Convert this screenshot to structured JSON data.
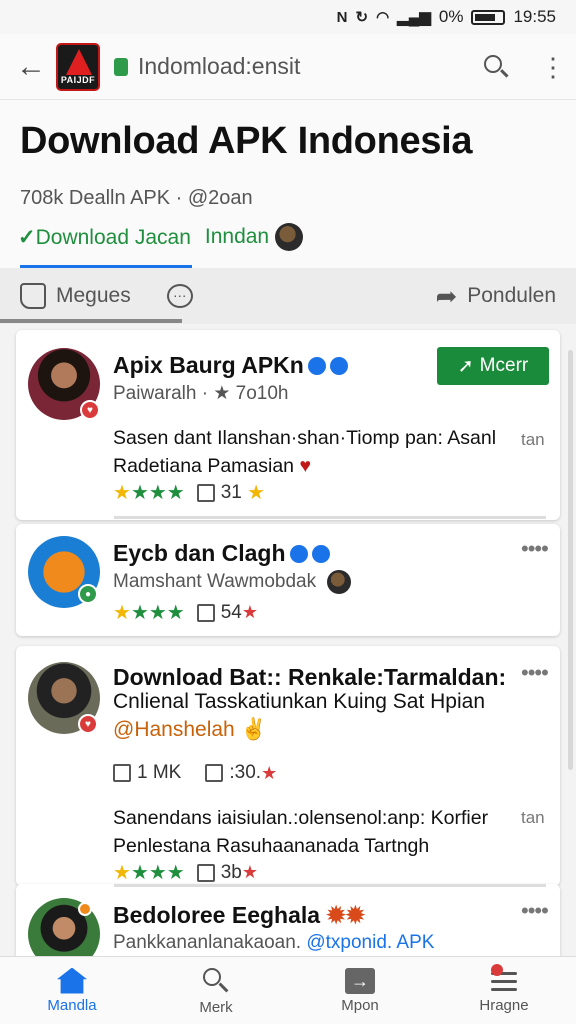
{
  "status_bar": {
    "battery": "0%",
    "time": "19:55",
    "icons": [
      "nfc-icon",
      "sync-icon",
      "wifi-icon",
      "signal-icon",
      "battery-icon"
    ]
  },
  "app_bar": {
    "url": "Indomload:ensit",
    "logo_text": "PAIJDF"
  },
  "header": {
    "title": "Download APK Indonesia",
    "subtitle": "708k Dealln APK · @2oan",
    "verified_label": "Download Jacan",
    "indo_label": "Inndan"
  },
  "action_bar": {
    "like_label": "Megues",
    "share_label": "Pondulen"
  },
  "posts": [
    {
      "title": "Apix Baurg APKn",
      "meta": "Paiwaralh · ★ 7o10h",
      "follow_label": "Mcerr",
      "body_line1": "Sasen dant Ilanshan·shan·Tiomp pan: Asanl",
      "body_line2": "Radetiana Pamasian",
      "side": "tan",
      "stat_count": "31"
    },
    {
      "title": "Eycb dan Clagh",
      "meta": "Mamshant Wawmobdak",
      "stat_count": "54"
    },
    {
      "title": "Download Bat:: Renkale:Tarmaldan:",
      "title_line2": "Cnlienal Tasskatiunkan Kuing Sat Hpian",
      "handle": "@Hanshelah",
      "stat_dl": "1 MK",
      "stat_count": ":30.",
      "body_line1": "Sanendans iaisiulan.:olensenol:anp: Korfier",
      "body_line2": "Penlestana Rasuhaananada Tartngh",
      "side": "tan",
      "stat_count2": "3b"
    },
    {
      "title": "Bedoloree Eeghala",
      "meta_prefix": "Pankkananlanakaoan.",
      "mention": "@txponid. APK"
    }
  ],
  "bottom_nav": {
    "home": "Mandla",
    "search": "Merk",
    "export": "Mpon",
    "menu": "Hragne"
  }
}
